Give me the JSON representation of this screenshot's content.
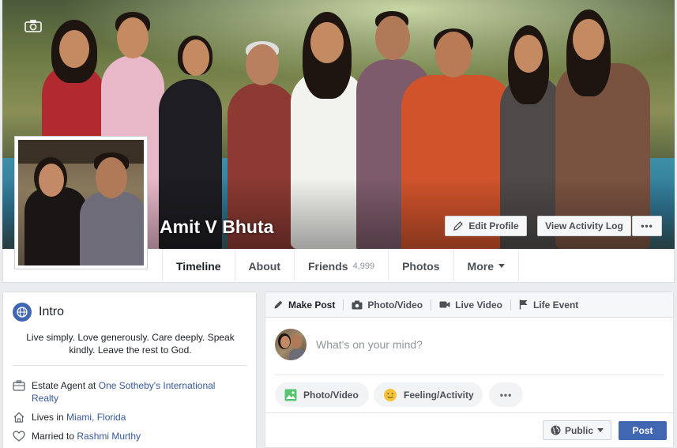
{
  "profile": {
    "name": "Amit V Bhuta",
    "edit_profile_label": "Edit Profile",
    "view_activity_log_label": "View Activity Log",
    "more_options_label": "•••"
  },
  "nav": {
    "tabs": [
      {
        "label": "Timeline",
        "active": true
      },
      {
        "label": "About"
      },
      {
        "label": "Friends",
        "count": "4,999"
      },
      {
        "label": "Photos"
      },
      {
        "label": "More"
      }
    ]
  },
  "intro": {
    "title": "Intro",
    "bio": "Live simply. Love generously. Care deeply. Speak kindly. Leave the rest to God.",
    "work": {
      "prefix": "Estate Agent at ",
      "link": "One Sotheby's International Realty"
    },
    "lives": {
      "prefix": "Lives in ",
      "link": "Miami, Florida"
    },
    "married": {
      "prefix": "Married to ",
      "link": "Rashmi Murthy"
    }
  },
  "composer": {
    "tabs": [
      {
        "label": "Make Post",
        "icon": "pencil-icon"
      },
      {
        "label": "Photo/Video",
        "icon": "camera-icon"
      },
      {
        "label": "Live Video",
        "icon": "video-camera-icon"
      },
      {
        "label": "Life Event",
        "icon": "flag-icon"
      }
    ],
    "placeholder": "What's on your mind?",
    "photo_video_label": "Photo/Video",
    "feeling_activity_label": "Feeling/Activity",
    "more_label": "•••",
    "audience_label": "Public",
    "post_label": "Post"
  },
  "colors": {
    "brand": "#4267b2",
    "link": "#365899",
    "page_bg": "#e9ebee"
  }
}
